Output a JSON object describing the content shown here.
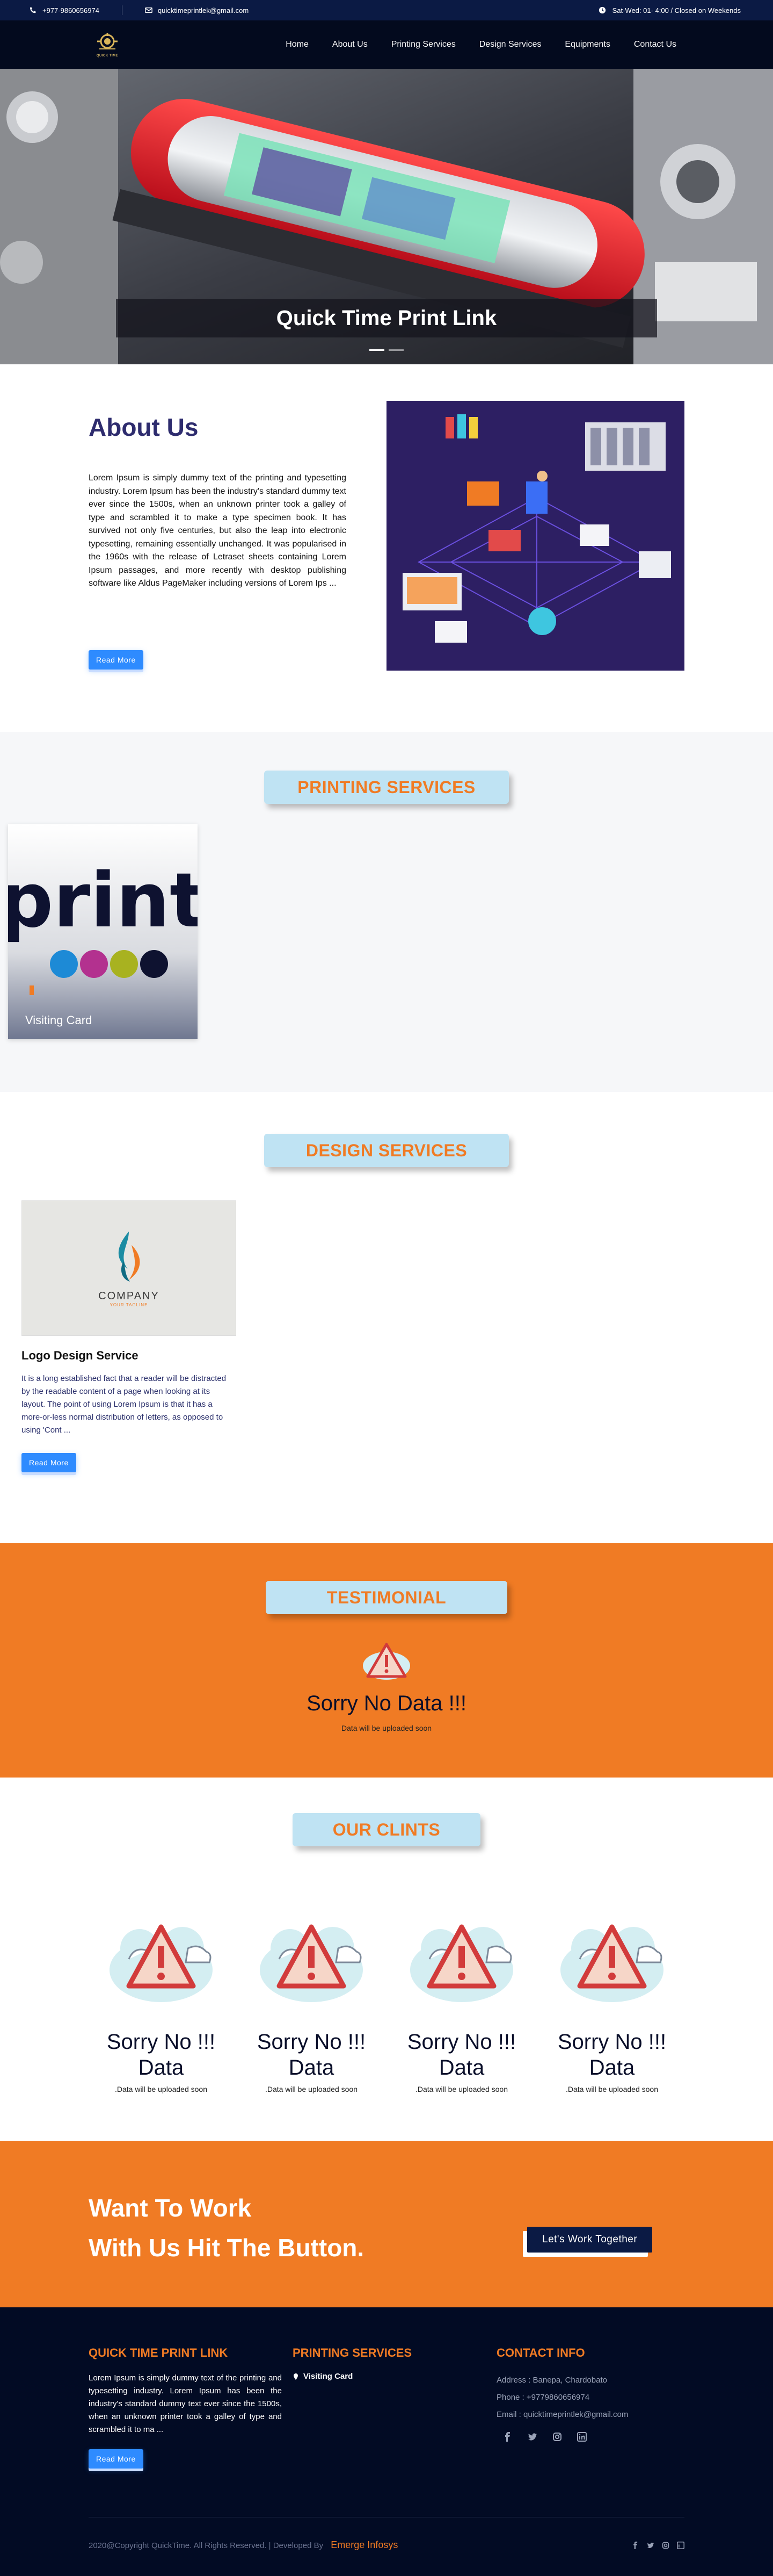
{
  "topbar": {
    "phone": "+977-9860656974",
    "email": "quicktimeprintlek@gmail.com",
    "hours": "Sat-Wed: 01- 4:00 / Closed on Weekends"
  },
  "nav": {
    "logo_text": "QUICK TIME",
    "items": [
      "Home",
      "About Us",
      "Printing Services",
      "Design Services",
      "Equipments",
      "Contact Us"
    ]
  },
  "hero": {
    "caption": "Quick Time Print Link"
  },
  "about": {
    "title": "About Us",
    "body": "Lorem Ipsum is simply dummy text of the printing and typesetting industry. Lorem Ipsum has been the industry's standard dummy text ever since the 1500s, when an unknown printer took a galley of type and scrambled it to make a type specimen book. It has survived not only five centuries, but also the leap into electronic typesetting, remaining essentially unchanged. It was popularised in the 1960s with the release of Letraset sheets containing Lorem Ipsum passages, and more recently with desktop publishing software like Aldus PageMaker including versions of Lorem Ips ...",
    "button": "Read More"
  },
  "printing": {
    "heading": "PRINTING SERVICES",
    "card_image_text": "print",
    "card_label": "Visiting Card"
  },
  "design": {
    "heading": "DESIGN SERVICES",
    "logo_company": "COMPANY",
    "logo_tagline": "YOUR TAGLINE",
    "title": "Logo Design Service",
    "body": "It is a long established fact that a reader will be distracted by the readable content of a page when looking at its layout. The point of using Lorem Ipsum is that it has a more-or-less normal distribution of letters, as opposed to using 'Cont ...",
    "button": "Read More"
  },
  "testimonial": {
    "heading": "TESTIMONIAL",
    "title": "Sorry No Data !!!",
    "sub": "Data will be uploaded soon"
  },
  "clients": {
    "heading": "OUR CLINTS",
    "items": [
      {
        "title": "Sorry No !!! Data",
        "sub": ".Data will be uploaded soon"
      },
      {
        "title": "Sorry No !!! Data",
        "sub": ".Data will be uploaded soon"
      },
      {
        "title": "Sorry No !!! Data",
        "sub": ".Data will be uploaded soon"
      },
      {
        "title": "Sorry No !!! Data",
        "sub": ".Data will be uploaded soon"
      }
    ]
  },
  "cta": {
    "line1": "Want To Work",
    "line2": "With Us Hit The Button.",
    "button": "Let's Work Together"
  },
  "footer": {
    "col1_title": "QUICK TIME PRINT LINK",
    "col1_body": "Lorem Ipsum is simply dummy text of the printing and typesetting industry. Lorem Ipsum has been the industry's standard dummy text ever since the 1500s, when an unknown printer took a galley of type and scrambled it to ma ...",
    "col1_button": "Read More",
    "col2_title": "PRINTING SERVICES",
    "col2_item": "Visiting Card",
    "col3_title": "CONTACT INFO",
    "address": "Address : Banepa, Chardobato",
    "phone": "Phone : +9779860656974",
    "email": "Email : quicktimeprintlek@gmail.com",
    "copyright": "2020@Copyright QuickTime. All Rights Reserved. | Developed By",
    "developer": "Emerge Infosys"
  },
  "colors": {
    "navy": "#0b1a44",
    "orange": "#f07b24",
    "pill": "#bfe3f3",
    "button": "#2e8bff"
  }
}
